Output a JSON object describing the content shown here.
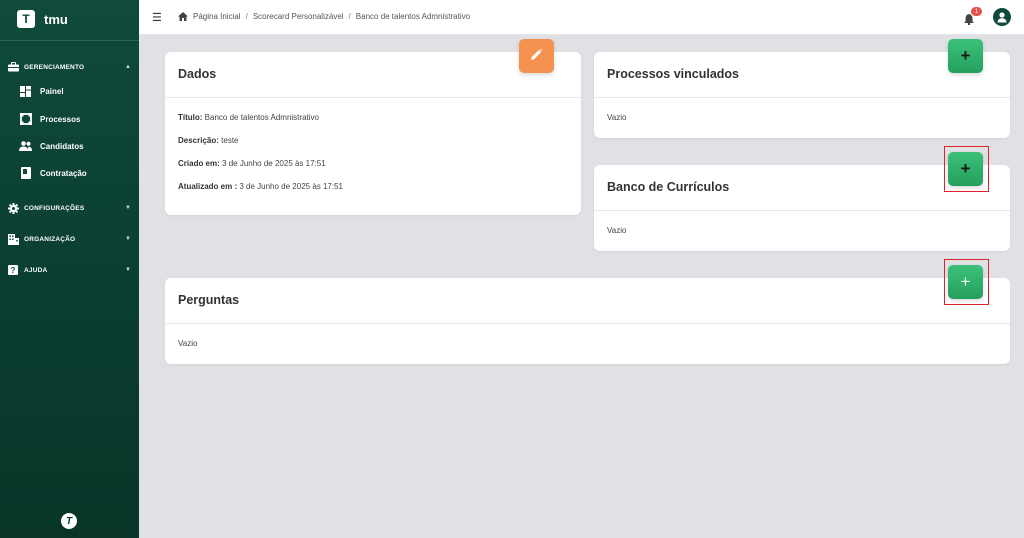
{
  "app": {
    "logo_letter": "T",
    "name": "tmu",
    "footer_logo_letter": "T"
  },
  "sidebar": {
    "groups": [
      {
        "label": "GERENCIAMENTO",
        "icon": "briefcase-icon",
        "expanded": true,
        "items": [
          {
            "label": "Painel",
            "icon": "dashboard-icon"
          },
          {
            "label": "Processos",
            "icon": "process-icon"
          },
          {
            "label": "Candidatos",
            "icon": "users-icon"
          },
          {
            "label": "Contratação",
            "icon": "contract-icon"
          }
        ]
      },
      {
        "label": "CONFIGURAÇÕES",
        "icon": "gear-icon",
        "expanded": false
      },
      {
        "label": "ORGANIZAÇÃO",
        "icon": "building-icon",
        "expanded": false
      },
      {
        "label": "AJUDA",
        "icon": "help-icon",
        "expanded": false
      }
    ]
  },
  "topbar": {
    "breadcrumb": [
      "Página Inicial",
      "Scorecard Personalizável",
      "Banco de talentos Admnistrativo"
    ],
    "notifications_count": "1"
  },
  "dados": {
    "title": "Dados",
    "fields": [
      {
        "label": "Título:",
        "value": "Banco de talentos Admnistrativo"
      },
      {
        "label": "Descrição:",
        "value": "teste"
      },
      {
        "label": "Criado em:",
        "value": "3 de Junho de 2025 às 17:51"
      },
      {
        "label": "Atualizado em :",
        "value": "3 de Junho de 2025 às 17:51"
      }
    ]
  },
  "processos": {
    "title": "Processos vinculados",
    "empty": "Vazio"
  },
  "curriculos": {
    "title": "Banco de Currículos",
    "empty": "Vazio"
  },
  "perguntas": {
    "title": "Perguntas",
    "empty": "Vazio"
  },
  "colors": {
    "sidebar": "#0f4a3a",
    "accent_green": "#2db36a",
    "edit_orange": "#f5924f",
    "highlight": "#e0232b",
    "badge": "#e55347"
  }
}
